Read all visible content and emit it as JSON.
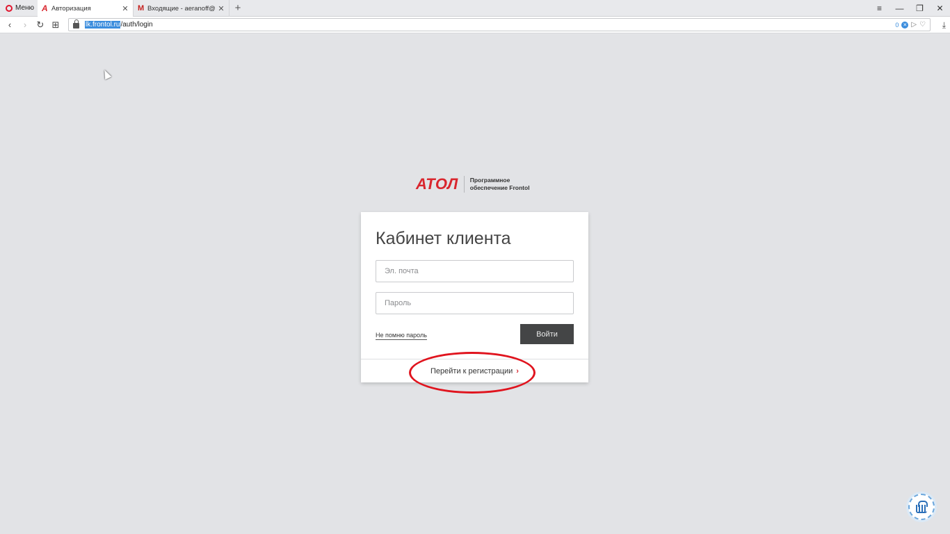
{
  "browser": {
    "menu_label": "Меню",
    "tabs": [
      {
        "title": "Авторизация",
        "active": true
      },
      {
        "title": "Входящие - aeranoff@gm",
        "active": false
      }
    ],
    "new_tab": "+",
    "url_host": "lk.frontol.ru",
    "url_path": "/auth/login",
    "adblock_count": "0"
  },
  "brand": {
    "logo": "АТОЛ",
    "tagline_line1": "Программное",
    "tagline_line2": "обеспечение Frontol"
  },
  "login": {
    "title": "Кабинет клиента",
    "email_placeholder": "Эл. почта",
    "password_placeholder": "Пароль",
    "forgot_label": "Не помню пароль",
    "submit_label": "Войти",
    "register_label": "Перейти к регистрации"
  },
  "colors": {
    "brand_red": "#d9262e",
    "annotation_red": "#e0141e",
    "button_dark": "#444546",
    "background": "#e2e3e6"
  }
}
